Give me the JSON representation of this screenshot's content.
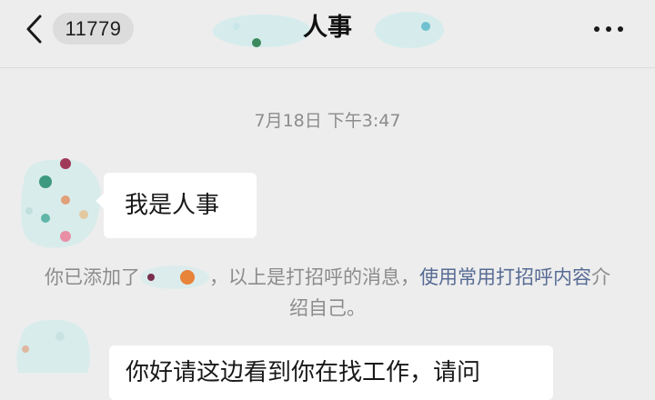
{
  "header": {
    "unread_count": "11779",
    "title": "人事"
  },
  "timestamp": "7月18日 下午3:47",
  "messages": [
    {
      "text": "我是人事"
    }
  ],
  "system_message": {
    "prefix": "你已添加了",
    "middle": "，以上是打招呼的消息，",
    "link": "使用常用打招呼内容",
    "suffix": "介绍自己。"
  },
  "partial_message": {
    "text": "你好请这边看到你在找工作，请问"
  },
  "colors": {
    "background": "#ededed",
    "bubble": "#ffffff",
    "link": "#576b95",
    "muted_text": "#8c8c8c"
  },
  "icons": [
    "back-chevron-icon",
    "more-icon",
    "avatar"
  ]
}
